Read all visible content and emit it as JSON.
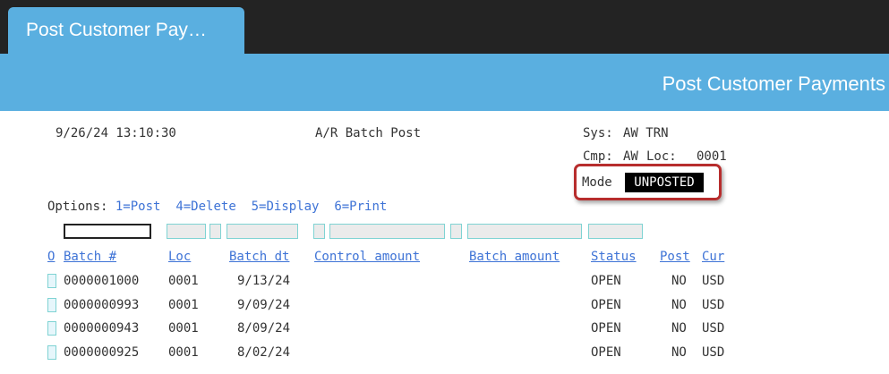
{
  "tab": {
    "title": "Post Customer Pay…"
  },
  "banner": {
    "title": "Post Customer Payments"
  },
  "header": {
    "datetime": "9/26/24 13:10:30",
    "program": "A/R Batch Post",
    "sys_label": "Sys:",
    "sys_value": "AW TRN",
    "cmp_label": "Cmp:",
    "cmp_value": "AW",
    "loc_label": "Loc:",
    "loc_value": "0001",
    "mode_label": "Mode",
    "mode_value": "UNPOSTED"
  },
  "options": {
    "label": "Options:",
    "items": [
      "1=Post",
      "4=Delete",
      "5=Display",
      "6=Print"
    ]
  },
  "columns": {
    "opt": "O",
    "batch": "Batch #",
    "loc": "Loc",
    "batch_dt": "Batch dt",
    "control_amount": "Control amount",
    "batch_amount": "Batch amount",
    "status": "Status",
    "post": "Post",
    "cur": "Cur"
  },
  "rows": [
    {
      "batch": "0000001000",
      "loc": "0001",
      "date": "9/13/24",
      "status": "OPEN",
      "post": "NO",
      "cur": "USD"
    },
    {
      "batch": "0000000993",
      "loc": "0001",
      "date": "9/09/24",
      "status": "OPEN",
      "post": "NO",
      "cur": "USD"
    },
    {
      "batch": "0000000943",
      "loc": "0001",
      "date": "8/09/24",
      "status": "OPEN",
      "post": "NO",
      "cur": "USD"
    },
    {
      "batch": "0000000925",
      "loc": "0001",
      "date": "8/02/24",
      "status": "OPEN",
      "post": "NO",
      "cur": "USD"
    }
  ]
}
